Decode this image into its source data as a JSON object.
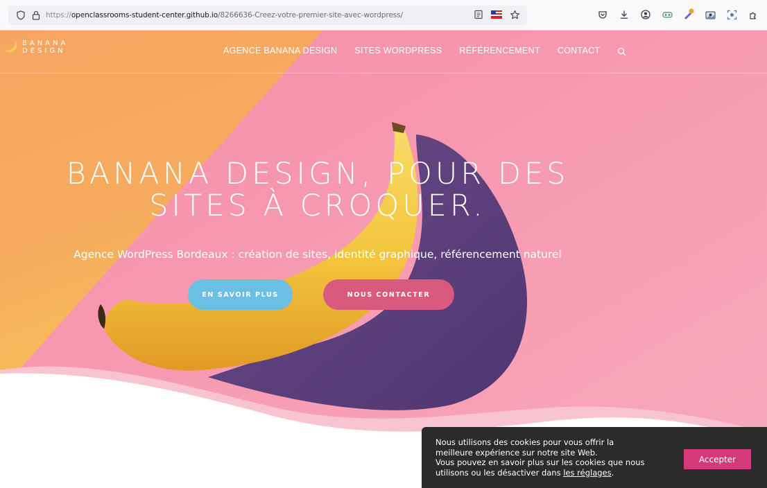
{
  "browser": {
    "url_protocol": "https://",
    "url_host": "openclassrooms-student-center.github.io",
    "url_path": "/8266636-Creez-votre-premier-site-avec-wordpress/",
    "icons": [
      "shield-icon",
      "lock-icon",
      "reader-icon",
      "flag-icon",
      "star-icon",
      "pocket-icon",
      "download-icon",
      "account-icon",
      "extension-icon",
      "edit-icon",
      "screenshot-icon",
      "capture-icon",
      "extensions-icon"
    ]
  },
  "site": {
    "logo_line1": "BANANA",
    "logo_line2": "DESIGN",
    "nav": [
      "AGENCE BANANA DESIGN",
      "SITES WORDPRESS",
      "RÉFÉRENCEMENT",
      "CONTACT"
    ],
    "hero_title_line1": "BANANA DESIGN, POUR DES",
    "hero_title_line2": "SITES À CROQUER.",
    "hero_subtitle": "Agence WordPress Bordeaux : création de sites, identité graphique, référencement naturel",
    "btn_more": "EN SAVOIR PLUS",
    "btn_contact": "NOUS CONTACTER"
  },
  "cookie": {
    "line1": "Nous utilisons des cookies pour vous offrir la",
    "line2": "meilleure expérience sur notre site Web.",
    "line3": "Vous pouvez en savoir plus sur les cookies que nous",
    "line4_prefix": "utilisons ou les désactiver dans ",
    "link": "les réglages",
    "line4_suffix": ".",
    "accept": "Accepter"
  },
  "colors": {
    "pink": "#f59cb4",
    "orange": "#f5a561",
    "yellow": "#f9d65a",
    "shadow_purple": "#5b3c7a",
    "btn_blue": "#6bbfe5",
    "btn_pink": "#d9597f",
    "cookie_bg": "#2b2b2b",
    "accept_bg": "#d6397a"
  }
}
